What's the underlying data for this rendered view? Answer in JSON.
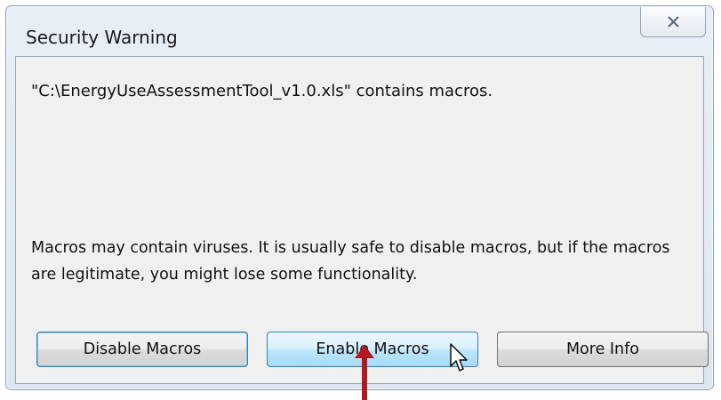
{
  "dialog": {
    "title": "Security Warning",
    "message": "\"C:\\EnergyUseAssessmentTool_v1.0.xls\" contains macros.",
    "warning": "Macros may contain viruses. It is usually safe to disable macros, but if the macros are legitimate, you might lose some functionality."
  },
  "buttons": {
    "disable": "Disable Macros",
    "enable": "Enable Macros",
    "more": "More Info"
  },
  "icons": {
    "close": "close-icon",
    "cursor": "mouse-pointer-icon",
    "annotation": "red-arrow-icon"
  },
  "colors": {
    "annotation_arrow": "#b0191e",
    "hover_button": "#bee6fd"
  }
}
